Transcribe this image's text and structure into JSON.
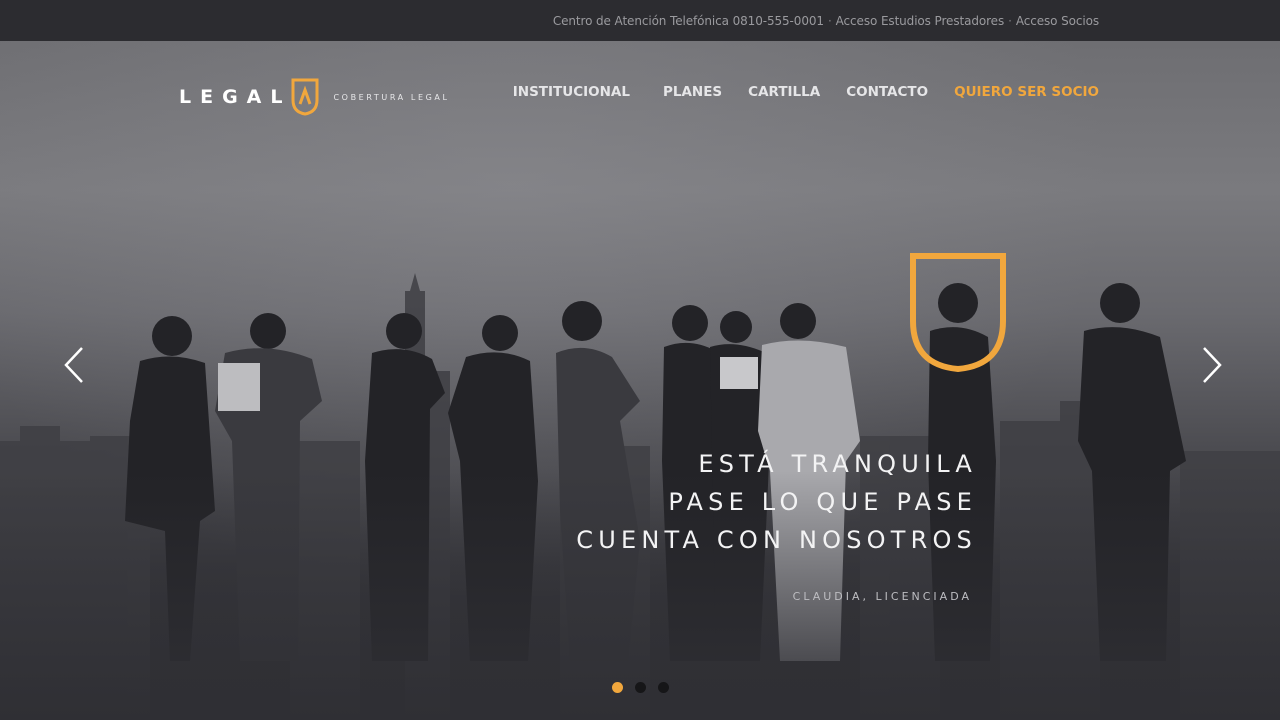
{
  "topbar": {
    "phone_text": "Centro de Atención Telefónica 0810-555-0001",
    "separator": "·",
    "link_prestadores": "Acceso Estudios Prestadores",
    "link_socios": "Acceso Socios"
  },
  "logo": {
    "word": "LEGAL",
    "tagline": "COBERTURA LEGAL"
  },
  "nav": {
    "items": [
      {
        "label": "INSTITUCIONAL"
      },
      {
        "label": "PLANES"
      },
      {
        "label": "CARTILLA"
      },
      {
        "label": "CONTACTO"
      }
    ],
    "cta_label": "QUIERO SER SOCIO"
  },
  "slider": {
    "quote_lines": [
      "ESTÁ TRANQUILA",
      "PASE LO QUE PASE",
      "CUENTA CON NOSOTROS"
    ],
    "author": "CLAUDIA, LICENCIADA",
    "slide_count": 3,
    "active_slide": 1
  },
  "colors": {
    "accent": "#f1a73d",
    "topbar_bg": "#2c2c30",
    "page_bg": "#2f2f34"
  },
  "icons": {
    "prev": "chevron-left-icon",
    "next": "chevron-right-icon",
    "brand": "shield-icon"
  }
}
